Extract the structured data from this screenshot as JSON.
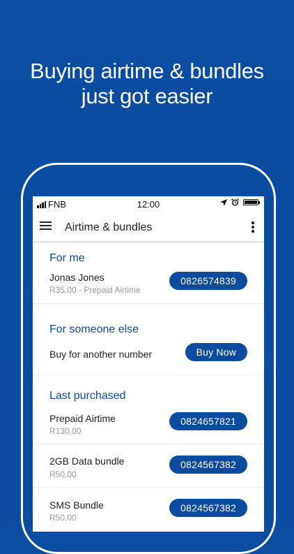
{
  "headline": {
    "line1": "Buying airtime & bundles",
    "line2": "just got easier"
  },
  "status": {
    "carrier": "FNB",
    "time": "12:00"
  },
  "appbar": {
    "title": "Airtime & bundles"
  },
  "for_me": {
    "title": "For me",
    "name": "Jonas Jones",
    "detail": "R35.00 - Prepaid Airtime",
    "number": "0826574839"
  },
  "someone_else": {
    "title": "For someone else",
    "label": "Buy for another number",
    "button": "Buy Now"
  },
  "last_purchased": {
    "title": "Last purchased",
    "items": [
      {
        "name": "Prepaid Airtime",
        "amount": "R130.00",
        "number": "0824657821"
      },
      {
        "name": "2GB Data bundle",
        "amount": "R50.00",
        "number": "0824567382"
      },
      {
        "name": "SMS Bundle",
        "amount": "R50.00",
        "number": "0824567382"
      }
    ]
  },
  "colors": {
    "brand": "#0b4c9e",
    "background": "#0a4da1"
  }
}
